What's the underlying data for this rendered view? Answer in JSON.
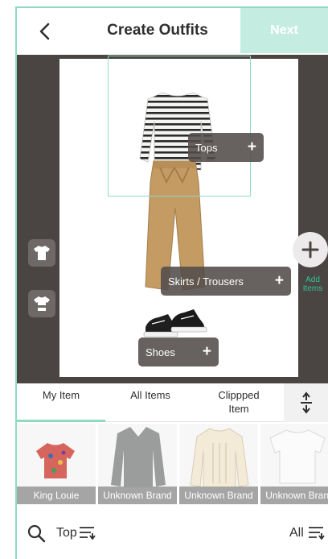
{
  "header": {
    "title": "Create Outfits",
    "next_label": "Next",
    "back_icon": "chevron-left-icon"
  },
  "canvas": {
    "tags": {
      "tops": "Tops",
      "bottoms": "Skirts / Trousers",
      "shoes": "Shoes"
    },
    "add_items_label": "Add Items",
    "accent_color": "#2fc59a",
    "selection_color": "#8fd9c3"
  },
  "tabs": [
    {
      "label": "My Item",
      "active": true
    },
    {
      "label": "All Items",
      "active": false
    },
    {
      "label": "Clippped Item",
      "active": false
    }
  ],
  "items": [
    {
      "brand": "King Louie"
    },
    {
      "brand": "Unknown Brand"
    },
    {
      "brand": "Unknown Brand"
    },
    {
      "brand": "Unknown Brand"
    }
  ],
  "bottom": {
    "category_label": "Top",
    "filter_label": "All"
  }
}
